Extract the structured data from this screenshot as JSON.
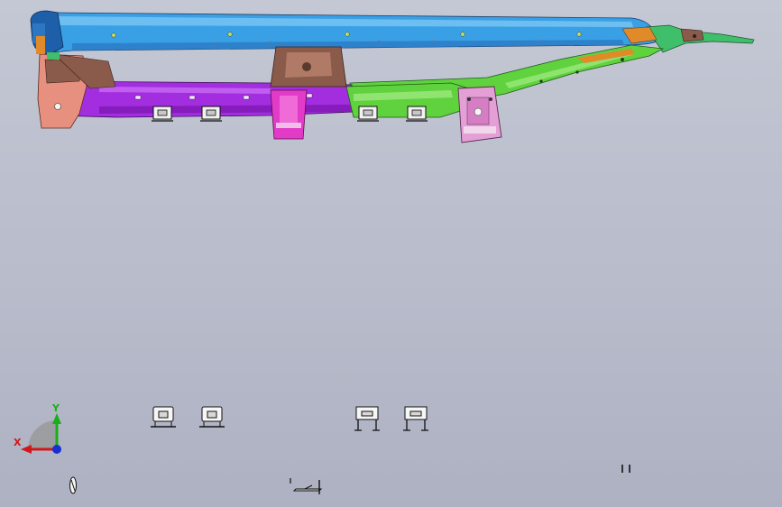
{
  "app": {
    "title": ""
  },
  "colors": {
    "background_top": "#c4c8d4",
    "background_bottom": "#adb1c2",
    "rail_blue": "#3aa0e6",
    "rail_blue_dark": "#1d5fa8",
    "lower_purple": "#a32ee0",
    "lower_green": "#5fd23e",
    "bracket_magenta": "#e23bc7",
    "bracket_pink": "#e4a0d6",
    "mount_brown": "#8a5a4a",
    "end_salmon": "#e89080",
    "accent_orange": "#e08a2a",
    "clip_white": "#f2f2f2",
    "axis_x": "#d01818",
    "axis_y": "#18b018",
    "axis_z": "#1830d0"
  },
  "triad": {
    "x_label": "X",
    "y_label": "Y"
  },
  "icons": {
    "axis": "coordinate-triad-icon",
    "clip": "clip-part-icon",
    "bracket": "bracket-part-icon"
  }
}
